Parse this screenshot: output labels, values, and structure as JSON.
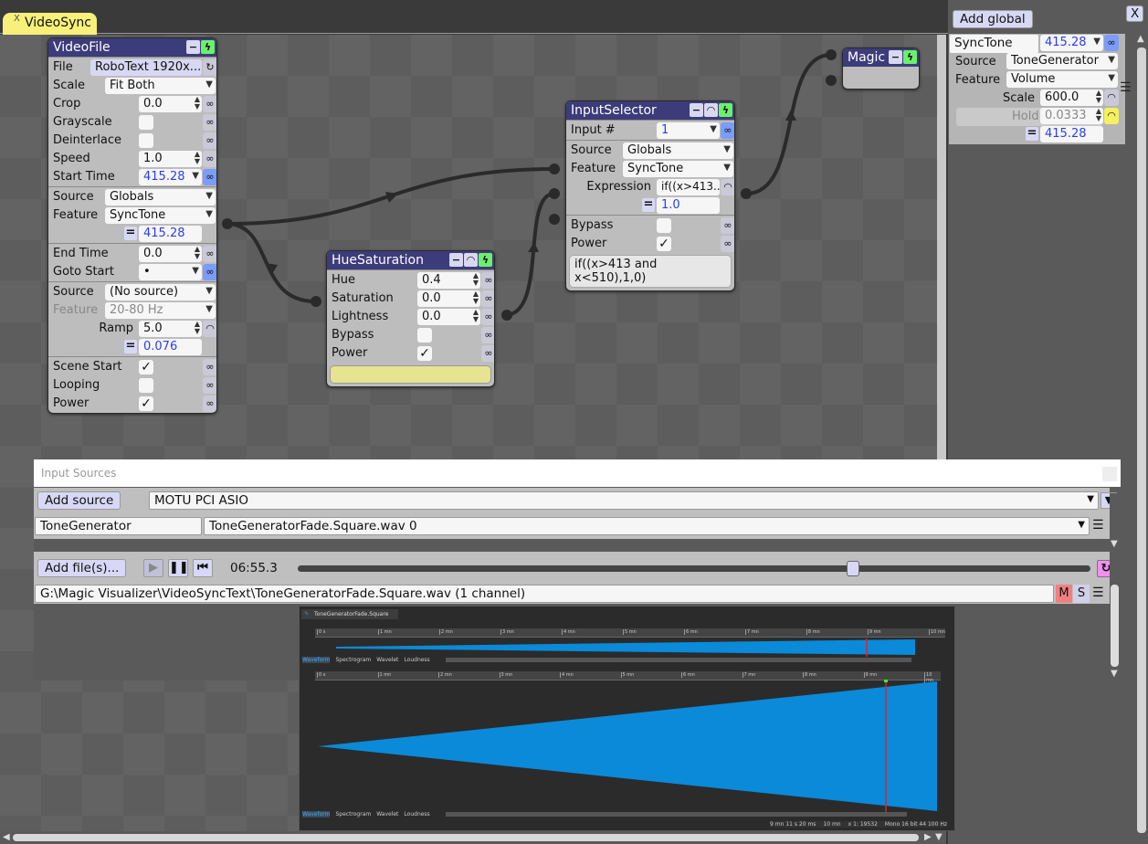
{
  "tab": {
    "close": "X",
    "title": "VideoSync"
  },
  "nodes": [
    {
      "title": "VideoFile",
      "title_buttons": [
        "minus-icon",
        "power-icon"
      ],
      "sections": [
        {
          "rows": [
            {
              "label": "File",
              "type": "file",
              "value": "RoboText 1920x...",
              "btn": "refresh"
            },
            {
              "label": "Scale",
              "type": "select",
              "wide": true,
              "value": "Fit Both"
            },
            {
              "label": "Crop",
              "type": "spin",
              "value": "0.0",
              "btn": "link"
            },
            {
              "label": "Grayscale",
              "type": "check",
              "checked": false,
              "btn": "link"
            },
            {
              "label": "Deinterlace",
              "type": "check",
              "checked": false,
              "btn": "link"
            },
            {
              "label": "Speed",
              "type": "spin",
              "value": "1.0",
              "btn": "link"
            },
            {
              "label": "Start Time",
              "type": "select",
              "value": "415.28",
              "blue": true,
              "btn": "link-active"
            }
          ]
        },
        {
          "rows": [
            {
              "label": "Source",
              "type": "select",
              "wide": true,
              "value": "Globals"
            },
            {
              "label": "Feature",
              "type": "select",
              "wide": true,
              "value": "SyncTone"
            },
            {
              "type": "eq",
              "value": "415.28"
            }
          ]
        },
        {
          "rows": [
            {
              "label": "End Time",
              "type": "spin",
              "value": "0.0",
              "btn": "link"
            },
            {
              "label": "Goto Start",
              "type": "select",
              "value": "•",
              "plain": true,
              "btn": "link-active"
            }
          ]
        },
        {
          "rows": [
            {
              "label": "Source",
              "type": "select",
              "wide": true,
              "value": "(No source)"
            },
            {
              "label": "Feature",
              "type": "select",
              "wide": true,
              "value": "20-80 Hz",
              "disabled": true
            },
            {
              "label": "Ramp",
              "type": "spin",
              "value": "5.0",
              "right": true,
              "btn": "listen"
            },
            {
              "type": "eq",
              "value": "0.076"
            }
          ]
        },
        {
          "rows": [
            {
              "label": "Scene Start",
              "type": "check",
              "checked": true,
              "btn": "link"
            },
            {
              "label": "Looping",
              "type": "check",
              "checked": false,
              "btn": "link"
            },
            {
              "label": "Power",
              "type": "check",
              "checked": true,
              "btn": "link"
            }
          ]
        }
      ]
    },
    {
      "title": "HueSaturation",
      "title_buttons": [
        "minus-icon",
        "listen-icon",
        "power-icon"
      ],
      "sections": [
        {
          "rows": [
            {
              "label": "Hue",
              "type": "spin",
              "value": "0.4",
              "btn": "link"
            },
            {
              "label": "Saturation",
              "type": "spin",
              "value": "0.0",
              "btn": "link"
            },
            {
              "label": "Lightness",
              "type": "spin",
              "value": "0.0",
              "btn": "link"
            },
            {
              "label": "Bypass",
              "type": "check",
              "checked": false,
              "btn": "link"
            },
            {
              "label": "Power",
              "type": "check",
              "checked": true,
              "btn": "link"
            },
            {
              "type": "swatch",
              "color": "#e7e491"
            }
          ]
        }
      ]
    },
    {
      "title": "InputSelector",
      "title_buttons": [
        "minus-icon",
        "listen-icon",
        "power-icon"
      ],
      "sections": [
        {
          "rows": [
            {
              "label": "Input #",
              "type": "select",
              "value": "1",
              "blue": true,
              "btn": "link-active"
            }
          ]
        },
        {
          "rows": [
            {
              "label": "Source",
              "type": "select",
              "wide": true,
              "value": "Globals"
            },
            {
              "label": "Feature",
              "type": "select",
              "wide": true,
              "value": "SyncTone"
            },
            {
              "label": "Expression",
              "type": "text",
              "value": "if((x>413...",
              "right": true,
              "btn": "listen"
            },
            {
              "type": "eq",
              "value": "1.0"
            }
          ]
        },
        {
          "rows": [
            {
              "label": "Bypass",
              "type": "check",
              "checked": false,
              "btn": "link"
            },
            {
              "label": "Power",
              "type": "check",
              "checked": true,
              "btn": "link"
            },
            {
              "type": "textarea",
              "value": "if((x>413 and\nx<510),1,0)"
            }
          ]
        }
      ]
    },
    {
      "title": "Magic",
      "title_buttons": [
        "minus-icon",
        "power-icon"
      ],
      "sections": []
    }
  ],
  "globals_panel": {
    "add_label": "Add global",
    "close": "X",
    "name": "SyncTone",
    "value": "415.28",
    "source_label": "Source",
    "source": "ToneGenerator",
    "feature_label": "Feature",
    "feature": "Volume",
    "scale_label": "Scale",
    "scale": "600.0",
    "hold_label": "Hold",
    "hold": "0.0333",
    "output": "415.28"
  },
  "input_sources": {
    "title": "Input Sources",
    "add_source": "Add source",
    "device": "MOTU PCI ASIO",
    "source_name": "ToneGenerator",
    "source_file": "ToneGeneratorFade.Square.wav 0",
    "add_files": "Add file(s)...",
    "time": "06:55.3",
    "playback_progress": 0.7,
    "file_path": "G:\\Magic Visualizer\\VideoSyncText\\ToneGeneratorFade.Square.wav (1 channel)",
    "mute": "M",
    "solo": "S",
    "colors": {
      "mute": "#f08080",
      "loop": "#f090f0"
    }
  },
  "waveform": {
    "tab": "ToneGeneratorFade.Square",
    "ruler": [
      "0 s",
      "1 mn",
      "2 mn",
      "3 mn",
      "4 mn",
      "5 mn",
      "6 mn",
      "7 mn",
      "8 mn",
      "9 mn",
      "10 mn"
    ],
    "view_tabs": [
      "Waveform",
      "Spectrogram",
      "Wavelet",
      "Loudness"
    ],
    "status": {
      "position": "9 mn 11 s 20 ms",
      "length": "10 mn",
      "zoom": "x 1: 19532",
      "format": "Mono 16 bit 44 100 Hz"
    },
    "colors": {
      "wave": "#0a8ad8",
      "cursor": "#e02030"
    }
  }
}
